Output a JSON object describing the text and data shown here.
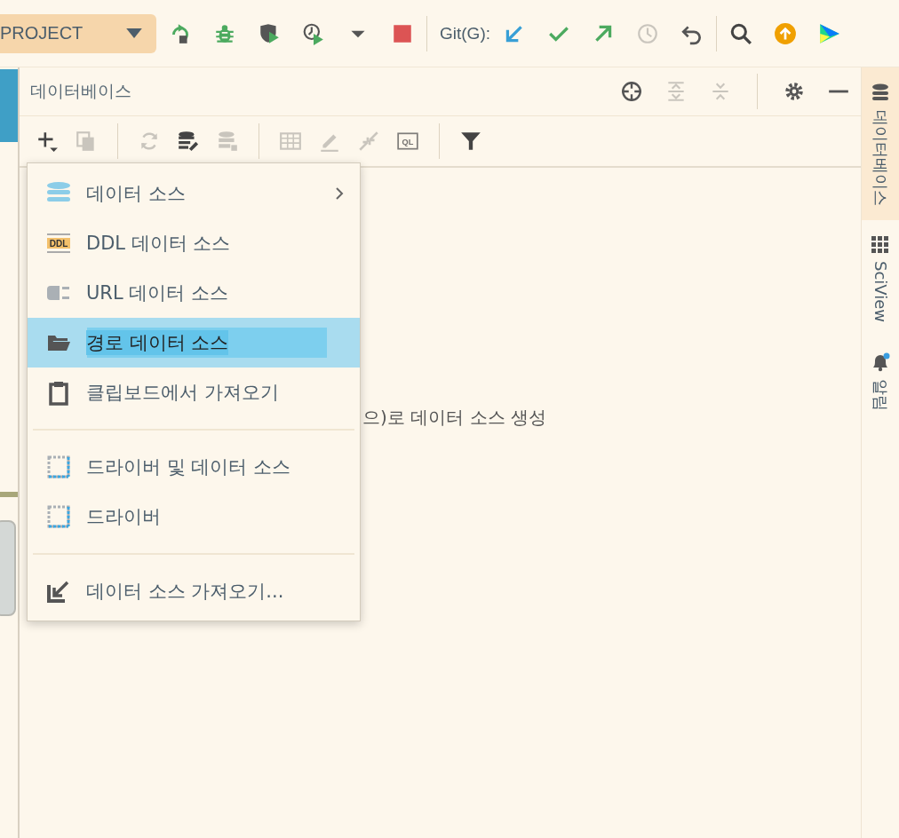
{
  "main_toolbar": {
    "project": "PROJECT",
    "run_tools": [
      {
        "kind": "rerun",
        "disabled": false
      },
      {
        "kind": "debug",
        "disabled": false
      },
      {
        "kind": "coverage",
        "disabled": false
      },
      {
        "kind": "profile",
        "disabled": false
      },
      {
        "kind": "caret",
        "disabled": false
      },
      {
        "kind": "stop",
        "disabled": false
      }
    ],
    "git_label": "Git(G):",
    "git_tools": [
      {
        "kind": "update",
        "disabled": false
      },
      {
        "kind": "commit",
        "disabled": false
      },
      {
        "kind": "push",
        "disabled": false
      },
      {
        "kind": "history",
        "disabled": true
      },
      {
        "kind": "rollback",
        "disabled": false
      }
    ],
    "extra_tools": [
      {
        "kind": "search",
        "disabled": false
      },
      {
        "kind": "upgrade",
        "disabled": false
      },
      {
        "kind": "logo",
        "disabled": false
      }
    ]
  },
  "panel": {
    "title": "데이터베이스",
    "header_tools": [
      {
        "kind": "locate",
        "disabled": false
      },
      {
        "kind": "expand",
        "disabled": true
      },
      {
        "kind": "collapse",
        "disabled": true
      },
      {
        "kind": "sep"
      },
      {
        "kind": "gear",
        "disabled": false
      },
      {
        "kind": "minimize",
        "disabled": false
      }
    ],
    "toolbar": [
      {
        "kind": "add",
        "disabled": false
      },
      {
        "kind": "copy",
        "disabled": true
      },
      {
        "kind": "sep"
      },
      {
        "kind": "refresh",
        "disabled": true
      },
      {
        "kind": "dbwrench",
        "disabled": false
      },
      {
        "kind": "db",
        "disabled": true
      },
      {
        "kind": "sep"
      },
      {
        "kind": "table",
        "disabled": true
      },
      {
        "kind": "edit",
        "disabled": true
      },
      {
        "kind": "jump",
        "disabled": true
      },
      {
        "kind": "ql",
        "disabled": true,
        "text": "QL"
      },
      {
        "kind": "sep"
      },
      {
        "kind": "filter",
        "disabled": false
      }
    ],
    "empty_hint": "으)로 데이터 소스 생성"
  },
  "menu": {
    "groups": [
      {
        "items": [
          {
            "kind": "database",
            "label": "데이터 소스",
            "submenu": true,
            "selected": false
          },
          {
            "kind": "ddl",
            "icon_text": "DDL",
            "label": "DDL 데이터 소스",
            "submenu": false,
            "selected": false
          },
          {
            "kind": "url",
            "label": "URL 데이터 소스",
            "submenu": false,
            "selected": false
          },
          {
            "kind": "folder",
            "label": "경로 데이터 소스",
            "submenu": false,
            "selected": true
          },
          {
            "kind": "clipboard",
            "label": "클립보드에서 가져오기",
            "submenu": false,
            "selected": false
          }
        ]
      },
      {
        "items": [
          {
            "kind": "driver",
            "label": "드라이버 및 데이터 소스",
            "submenu": false,
            "selected": false
          },
          {
            "kind": "driver",
            "label": "드라이버",
            "submenu": false,
            "selected": false
          }
        ]
      },
      {
        "items": [
          {
            "kind": "import",
            "label": "데이터 소스 가져오기...",
            "submenu": false,
            "selected": false
          }
        ]
      }
    ]
  },
  "right_stripe": [
    {
      "kind": "database",
      "label": "데이터베이스",
      "selected": true
    },
    {
      "kind": "sciview",
      "label": "SciView",
      "selected": false
    },
    {
      "kind": "bell",
      "label": "알림",
      "selected": false
    }
  ]
}
